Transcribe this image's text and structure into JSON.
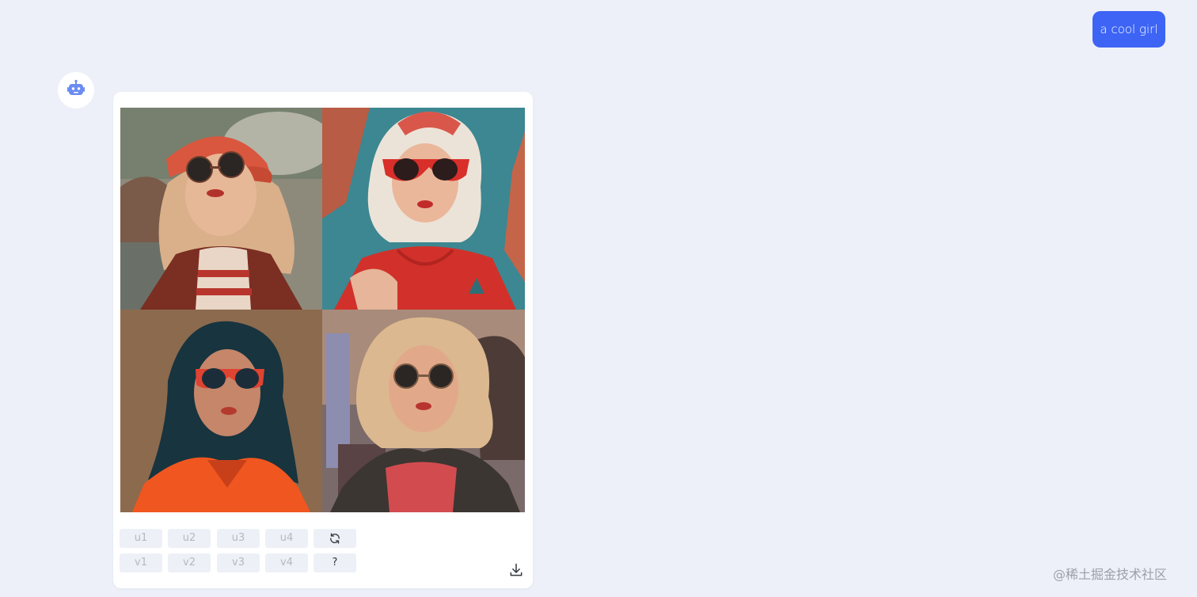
{
  "conversation": {
    "user_message": "a cool girl",
    "bot_avatar_icon": "robot-icon"
  },
  "result_card": {
    "images": [
      {
        "name": "generated-image-1",
        "description": "girl with red cap and round dark sunglasses, blonde hair, red jacket"
      },
      {
        "name": "generated-image-2",
        "description": "girl with platinum hair, red cat-eye sunglasses, red t-shirt, teal background"
      },
      {
        "name": "generated-image-3",
        "description": "girl with dark teal hair, red-framed sunglasses, orange shirt, brown background"
      },
      {
        "name": "generated-image-4",
        "description": "girl with wavy blonde hair, round dark sunglasses, black jacket, street background"
      }
    ],
    "upscale_buttons": [
      "u1",
      "u2",
      "u3",
      "u4"
    ],
    "variation_buttons": [
      "v1",
      "v2",
      "v3",
      "v4"
    ],
    "refresh_icon": "refresh-icon",
    "help_label": "?",
    "download_icon": "download-icon"
  },
  "watermark": "@稀土掘金技术社区",
  "colors": {
    "page_background": "#edf0f8",
    "user_bubble": "#3d64f5",
    "card_background": "#ffffff",
    "button_background": "#edf0f6",
    "button_text": "#b3b9c4",
    "bot_icon": "#6b8cf2"
  }
}
